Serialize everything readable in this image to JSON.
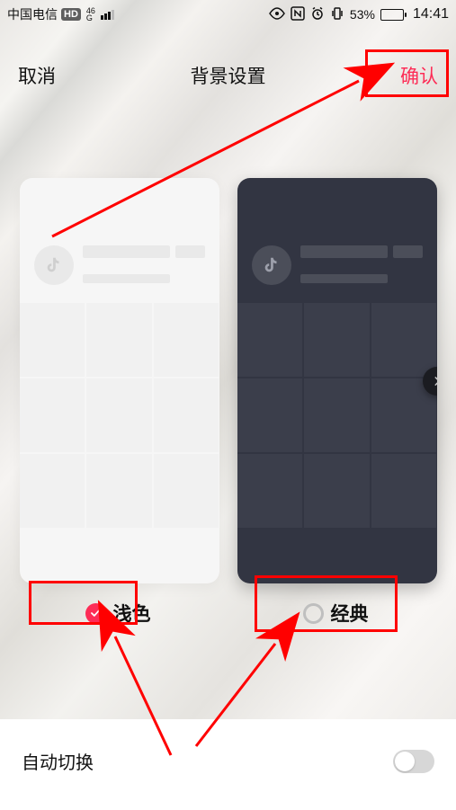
{
  "status": {
    "carrier": "中国电信",
    "hd": "HD",
    "net_top": "46",
    "net_bot": "G",
    "battery": "53%",
    "time": "14:41"
  },
  "header": {
    "cancel": "取消",
    "title": "背景设置",
    "confirm": "确认"
  },
  "themes": {
    "light_label": "浅色",
    "dark_label": "经典"
  },
  "auto": {
    "label": "自动切换",
    "enabled": false
  },
  "colors": {
    "accent": "#fd2c56",
    "annotation": "#ff0000"
  }
}
